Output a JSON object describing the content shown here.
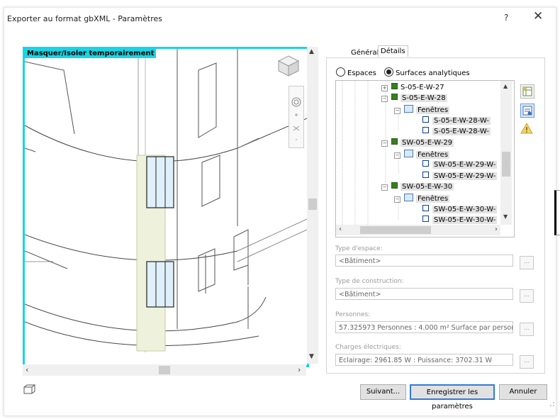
{
  "dialog": {
    "title": "Exporter au format gbXML - Paramètres",
    "help_label": "?",
    "close_label": "✕"
  },
  "viewport": {
    "label": "Masquer/Isoler temporairement",
    "highlight_color": "#19d5e4"
  },
  "tabs": [
    {
      "label": "Général",
      "active": false
    },
    {
      "label": "Détails",
      "active": true
    }
  ],
  "radios": [
    {
      "label": "Espaces",
      "checked": false
    },
    {
      "label": "Surfaces analytiques",
      "checked": true
    }
  ],
  "tree": {
    "items": [
      {
        "label": "S-05-E-W-27",
        "type": "surface",
        "expander": "+"
      },
      {
        "label": "S-05-E-W-28",
        "type": "surface",
        "expander": "−"
      },
      {
        "label": "Fenêtres",
        "type": "folder",
        "expander": "−"
      },
      {
        "label": "S-05-E-W-28-W-",
        "type": "window"
      },
      {
        "label": "S-05-E-W-28-W-",
        "type": "window"
      },
      {
        "label": "SW-05-E-W-29",
        "type": "surface",
        "expander": "−"
      },
      {
        "label": "Fenêtres",
        "type": "folder",
        "expander": "−"
      },
      {
        "label": "SW-05-E-W-29-W-",
        "type": "window"
      },
      {
        "label": "SW-05-E-W-29-W-",
        "type": "window"
      },
      {
        "label": "SW-05-E-W-30",
        "type": "surface",
        "expander": "−"
      },
      {
        "label": "Fenêtres",
        "type": "folder",
        "expander": "−"
      },
      {
        "label": "SW-05-E-W-30-W-",
        "type": "window"
      },
      {
        "label": "SW-05-E-W-30-W-",
        "type": "window"
      }
    ]
  },
  "fields": {
    "space_type": {
      "label": "Type d'espace:",
      "value": "<Bâtiment>"
    },
    "construction_type": {
      "label": "Type de construction:",
      "value": "<Bâtiment>"
    },
    "people": {
      "label": "Personnes:",
      "value": "57.325973 Personnes : 4.000 m² Surface par personn"
    },
    "electrical_loads": {
      "label": "Charges électriques:",
      "value": "Eclairage: 2961.85 W : Puissance: 3702.31 W"
    },
    "dots_label": "..."
  },
  "buttons": {
    "next": "Suivant...",
    "save": "Enregistrer les paramètres",
    "cancel": "Annuler"
  },
  "colors": {
    "accent": "#2f7bd6",
    "surface_green": "#3a7d22"
  }
}
